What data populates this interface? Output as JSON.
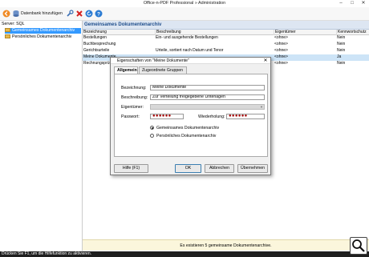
{
  "window": {
    "title": "Office-n-PDF Professional  »  Administration"
  },
  "toolbar": {
    "add_db_label": "Datenbank hinzufügen"
  },
  "tree": {
    "server_label": "Server: SQL",
    "items": [
      {
        "label": "Gemeinsames Dokumentenarchiv",
        "selected": true
      },
      {
        "label": "Persönliches Dokumentenarchiv",
        "selected": false
      }
    ]
  },
  "main": {
    "title": "Gemeinsames Dokumentenarchiv",
    "columns": [
      "Bezeichnung",
      "Beschreibung",
      "Eigentümer",
      "Kennwortschutz"
    ],
    "rows": [
      {
        "name": "Bestellungen",
        "desc": "Ein- und ausgehende Bestellungen",
        "owner": "<ohne>",
        "pw": "Nein",
        "selected": false
      },
      {
        "name": "Buchbesprechung",
        "desc": "",
        "owner": "<ohne>",
        "pw": "Nein",
        "selected": false
      },
      {
        "name": "Gerichtsurteile",
        "desc": "Urteile, sortiert nach Datum und Tenor",
        "owner": "<ohne>",
        "pw": "Nein",
        "selected": false
      },
      {
        "name": "Meine Dokumente",
        "desc": "",
        "owner": "<ohne>",
        "pw": "Ja",
        "selected": true
      },
      {
        "name": "Rechnungsprüfung",
        "desc": "",
        "owner": "<ohne>",
        "pw": "Nein",
        "selected": false
      }
    ],
    "footer": "Es existieren 5 gemeinsame Dokumentenarchive."
  },
  "status": "Drücken Sie F1, um die Hilfefunktion zu aktivieren.",
  "dialog": {
    "title": "Eigenschaften von \"Meine Dokumente\"",
    "tabs": [
      "Allgemein",
      "Zugeordnete Gruppen"
    ],
    "labels": {
      "name": "Bezeichnung:",
      "desc": "Beschreibung:",
      "owner": "Eigentümer:",
      "password": "Passwort:",
      "repeat": "Wiederholung:"
    },
    "values": {
      "name": "Meine Dokumente",
      "desc": "Zur Verteilung freigegebene Unterlagen",
      "password": "●●●●●●",
      "repeat": "●●●●●●"
    },
    "radios": [
      {
        "label": "Gemeinsames Dokumentenarchiv",
        "checked": true
      },
      {
        "label": "Persönliches Dokumentenarchiv",
        "checked": false
      }
    ],
    "buttons": {
      "help": "Hilfe (F1)",
      "ok": "OK",
      "cancel": "Abbrechen",
      "apply": "Übernehmen"
    }
  },
  "colors": {
    "selection": "#3399ff",
    "banner_text": "#1f4e8c",
    "footer_bg": "#fbf6dc",
    "password_dots": "#a00000"
  }
}
